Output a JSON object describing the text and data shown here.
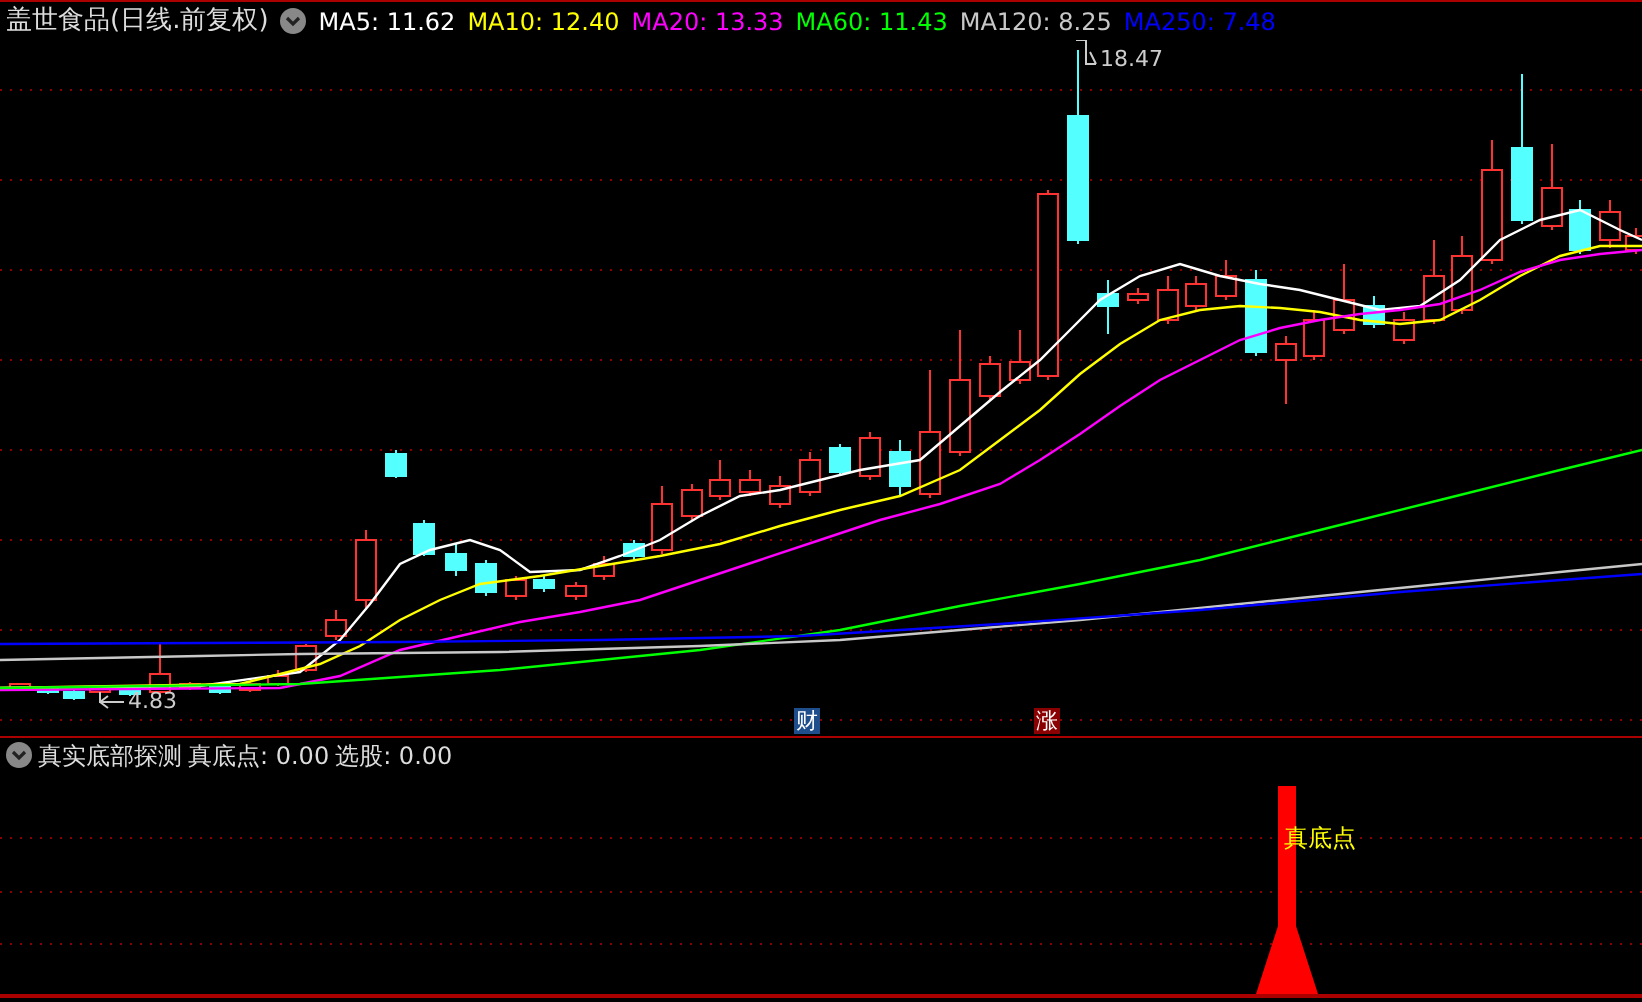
{
  "header": {
    "title": "盖世食品(日线.前复权)",
    "indicators": [
      {
        "label": "MA5: 11.62",
        "color": "#ffffff"
      },
      {
        "label": "MA10: 12.40",
        "color": "#ffff00"
      },
      {
        "label": "MA20: 13.33",
        "color": "#ff00ff"
      },
      {
        "label": "MA60: 11.43",
        "color": "#00ff00"
      },
      {
        "label": "MA120: 8.25",
        "color": "#c8c8c8"
      },
      {
        "label": "MA250: 7.48",
        "color": "#0000ff"
      }
    ]
  },
  "main_chart": {
    "high_label": "18.47",
    "low_label": "4.83",
    "markers": [
      {
        "text": "财",
        "color": "#1f4e8c"
      },
      {
        "text": "涨",
        "color": "#8b0000"
      }
    ]
  },
  "sub_panel": {
    "title": "真实底部探测",
    "values": [
      "真底点: 0.00",
      "选股: 0.00"
    ],
    "signal_label": "真底点"
  }
}
